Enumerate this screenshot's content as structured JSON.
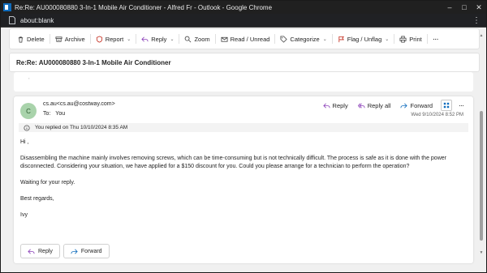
{
  "window": {
    "title": "Re:Re: AU000080880 3-In-1 Mobile Air Conditioner - Alfred Fr - Outlook - Google Chrome"
  },
  "address": {
    "url": "about:blank"
  },
  "toolbar": {
    "delete": "Delete",
    "archive": "Archive",
    "report": "Report",
    "reply": "Reply",
    "zoom": "Zoom",
    "read_unread": "Read / Unread",
    "categorize": "Categorize",
    "flag_unflag": "Flag / Unflag",
    "print": "Print"
  },
  "subject": "Re:Re: AU000080880 3-In-1 Mobile Air Conditioner",
  "message": {
    "avatar_initial": "C",
    "from": "cs.au<cs.au@costway.com>",
    "to_label": "To:",
    "to_value": "You",
    "date": "Wed 9/10/2024 8:52 PM",
    "actions": {
      "reply": "Reply",
      "reply_all": "Reply all",
      "forward": "Forward"
    },
    "notice": "You replied on Thu 10/10/2024 8:35 AM",
    "body": [
      "Hi ,",
      "Disassembling the machine mainly involves removing screws, which can be time-consuming but is not technically difficult. The process is safe as it is done with the power disconnected. Considering your situation, we have applied for a $150 discount for you. Could you please arrange for a technician to perform the operation?",
      "Waiting for your reply.",
      "Best regards,",
      "Ivy"
    ],
    "bottom_reply": "Reply",
    "bottom_forward": "Forward"
  },
  "colors": {
    "accent": "#0f6cbd",
    "reply_icon": "#8a3fb8",
    "forward_icon": "#0f6cbd",
    "report_icon": "#c42b1c",
    "flag_icon": "#c42b1c"
  },
  "icons": [
    "app-icon",
    "page-icon",
    "trash-icon",
    "archive-icon",
    "shield-icon",
    "reply-icon",
    "zoom-icon",
    "envelope-icon",
    "tag-icon",
    "flag-icon",
    "printer-icon",
    "more-icon",
    "reply-all-icon",
    "forward-icon",
    "grid-icon",
    "info-icon"
  ]
}
